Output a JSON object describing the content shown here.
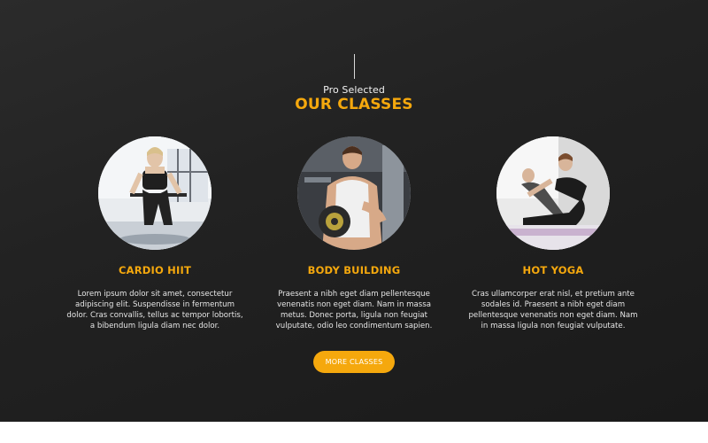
{
  "header": {
    "eyebrow": "Pro Selected",
    "title": "OUR CLASSES"
  },
  "classes": [
    {
      "name": "CARDIO HIIT",
      "description": "Lorem ipsum dolor sit amet, consectetur adipiscing elit. Suspendisse in fermentum dolor. Cras convallis, tellus ac tempor lobortis, a bibendum ligula diam nec dolor."
    },
    {
      "name": "BODY BUILDING",
      "description": "Praesent a nibh eget diam pellentesque venenatis non eget diam. Nam in massa metus. Donec porta, ligula non feugiat vulputate, odio leo condimentum sapien."
    },
    {
      "name": "HOT YOGA",
      "description": "Cras ullamcorper erat nisl, et pretium ante sodales id. Praesent a nibh eget diam pellentesque venenatis non eget diam. Nam in massa ligula non feugiat vulputate."
    }
  ],
  "cta": {
    "label": "MORE CLASSES"
  },
  "colors": {
    "accent": "#f5a80d",
    "background": "#232323"
  }
}
